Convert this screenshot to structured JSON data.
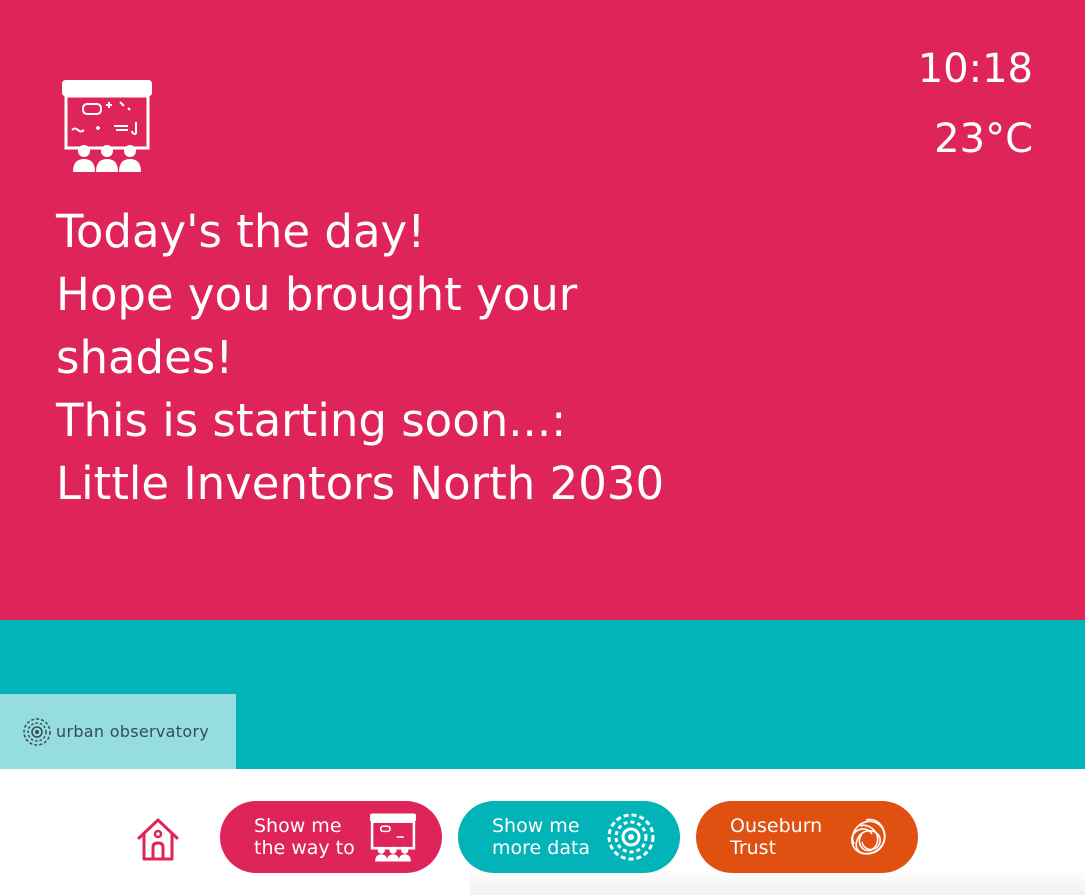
{
  "header": {
    "time": "10:18",
    "temperature": "23°C"
  },
  "message": {
    "lines": [
      "Today's the day!",
      "Hope you brought your",
      "shades!",
      "This is starting soon...:",
      "Little Inventors North 2030"
    ]
  },
  "branding": {
    "label": "urban observatory"
  },
  "nav": {
    "way_line1": "Show me",
    "way_line2": "the way to",
    "data_line1": "Show me",
    "data_line2": "more data",
    "trust_line1": "Ouseburn",
    "trust_line2": "Trust"
  },
  "colors": {
    "hero": "#df245a",
    "teal": "#02b3b8",
    "orange": "#e05010",
    "light_teal": "#95dde0"
  },
  "icons": [
    "event-stall-icon",
    "urban-observatory-logo-icon",
    "home-icon",
    "data-radar-icon",
    "ouseburn-trust-logo-icon"
  ]
}
